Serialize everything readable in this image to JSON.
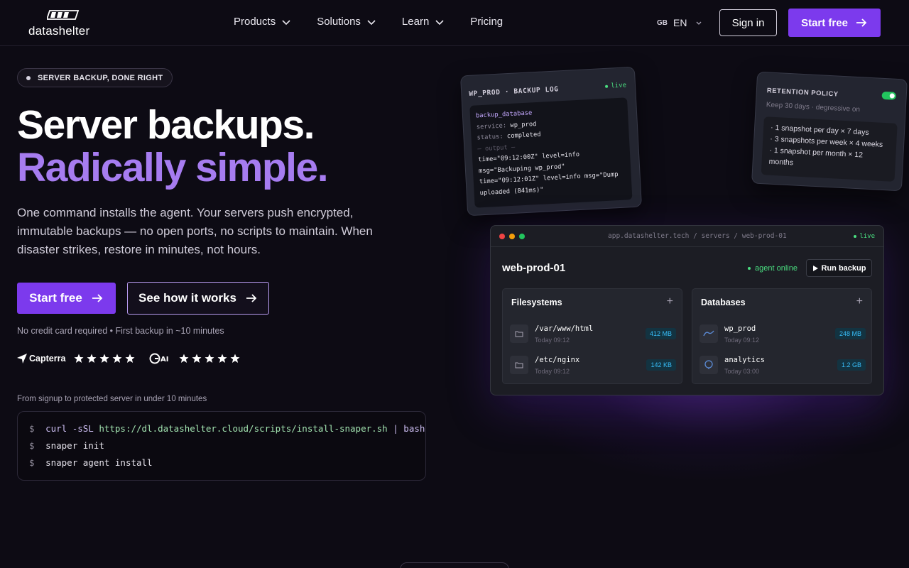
{
  "brand": {
    "name": "datashelter"
  },
  "nav": {
    "links": [
      {
        "label": "Products",
        "has_menu": true
      },
      {
        "label": "Solutions",
        "has_menu": true
      },
      {
        "label": "Learn",
        "has_menu": true
      },
      {
        "label": "Pricing",
        "has_menu": false
      }
    ],
    "lang_flag": "GB",
    "lang_code": "EN",
    "signin_label": "Sign in",
    "start_label": "Start free"
  },
  "hero": {
    "badge": "SERVER BACKUP, DONE RIGHT",
    "title_line1": "Server backups.",
    "title_line2": "Radically simple.",
    "lead": "One command installs the agent. Your servers push encrypted, immutable backups — no open ports, no scripts to maintain. When disaster strikes, restore in minutes, not hours.",
    "cta_primary": "Start free",
    "cta_secondary": "See how it works",
    "fine_print": "No credit card required • First backup in ~10 minutes",
    "ratings": [
      {
        "name": "Capterra",
        "stars": 5
      },
      {
        "name": "G2",
        "stars": 5
      }
    ],
    "signup_caption": "From signup to protected server in under 10 minutes",
    "terminal": {
      "prompt": "$",
      "lines": [
        {
          "cmd": "curl -sSL",
          "url": "https://dl.datashelter.cloud/scripts/install-snaper.sh",
          "rest": "| bash"
        },
        {
          "cmd": "snaper init"
        },
        {
          "cmd": "snaper agent install"
        }
      ]
    }
  },
  "log_card": {
    "title": "WP_PROD · BACKUP LOG",
    "status": "live",
    "fn": "backup_database",
    "service_key": "service:",
    "service_val": "wp_prod",
    "status_key": "status:",
    "status_val": "completed",
    "sep": "— output —",
    "line1": "time=\"09:12:00Z\" level=info",
    "line2": "msg=\"Backuping wp_prod\"",
    "line3": "time=\"09:12:01Z\" level=info msg=\"Dump",
    "line4": "uploaded (841ms)\""
  },
  "retention_card": {
    "title": "RETENTION POLICY",
    "subtitle": "Keep 30 days · degressive on",
    "enabled": true,
    "rules": [
      "· 1 snapshot per day × 7 days",
      "· 3 snapshots per week × 4 weeks",
      "· 1 snapshot per month × 12 months"
    ]
  },
  "app_card": {
    "url": "app.datashelter.tech / servers / web-prod-01",
    "status": "live",
    "server_name": "web-prod-01",
    "agent_status": "agent online",
    "run_label": "Run backup",
    "filesystems": {
      "title": "Filesystems",
      "items": [
        {
          "name": "/var/www/html",
          "time": "Today 09:12",
          "size": "412 MB"
        },
        {
          "name": "/etc/nginx",
          "time": "Today 09:12",
          "size": "142 KB"
        }
      ]
    },
    "databases": {
      "title": "Databases",
      "items": [
        {
          "name": "wp_prod",
          "time": "Today 09:12",
          "size": "248 MB",
          "icon": "mysql-icon"
        },
        {
          "name": "analytics",
          "time": "Today 03:00",
          "size": "1.2 GB",
          "icon": "postgres-icon"
        }
      ]
    }
  },
  "colors": {
    "accent": "#7c3aed",
    "accent_text": "#a67cf0",
    "background": "#0d0b14",
    "live_green": "#4ade80",
    "size_badge": "#38bdf8"
  }
}
